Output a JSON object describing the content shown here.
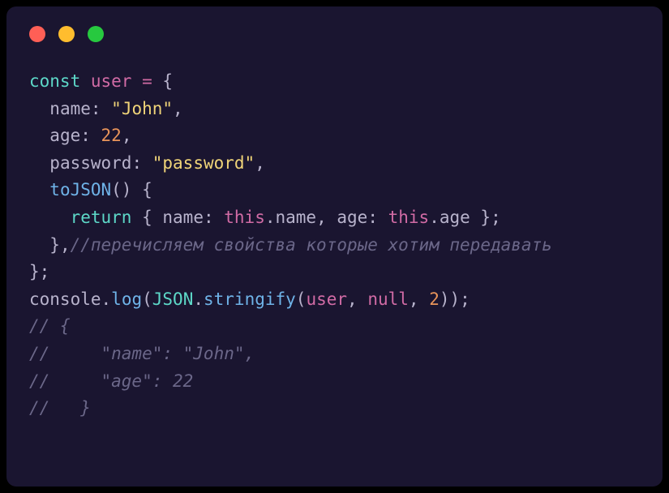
{
  "traffic_lights": {
    "red": "#ff5f56",
    "yellow": "#ffbd2e",
    "green": "#27c93f"
  },
  "code": {
    "l1": {
      "const": "const",
      "var": "user",
      "eq": " = ",
      "brace": "{"
    },
    "l2": {
      "indent": "  ",
      "prop": "name",
      "colon": ": ",
      "val": "\"John\"",
      "comma": ","
    },
    "l3": {
      "indent": "  ",
      "prop": "age",
      "colon": ": ",
      "val": "22",
      "comma": ","
    },
    "l4": {
      "indent": "  ",
      "prop": "password",
      "colon": ": ",
      "val": "\"password\"",
      "comma": ","
    },
    "l5": {
      "indent": "  ",
      "method": "toJSON",
      "parens": "()",
      "sp": " ",
      "brace": "{"
    },
    "l6": {
      "indent": "    ",
      "return": "return",
      "sp1": " ",
      "lb": "{ ",
      "p1": "name",
      "c1": ": ",
      "this1": "this",
      "dot1": ".",
      "n1": "name",
      "comma1": ", ",
      "p2": "age",
      "c2": ": ",
      "this2": "this",
      "dot2": ".",
      "n2": "age",
      "rb": " };"
    },
    "l7": {
      "indent": "  ",
      "brace": "},",
      "comment": "//перечисляем свойства которые хотим передавать"
    },
    "l8": {
      "brace": "};"
    },
    "l9": {
      "console": "console",
      "dot1": ".",
      "log": "log",
      "lp": "(",
      "json": "JSON",
      "dot2": ".",
      "stringify": "stringify",
      "lp2": "(",
      "arg1": "user",
      "comma1": ", ",
      "null": "null",
      "comma2": ", ",
      "two": "2",
      "rp": "));"
    },
    "l10": "// {",
    "l11": "//     \"name\": \"John\",",
    "l12": "//     \"age\": 22",
    "l13": "//   }"
  }
}
